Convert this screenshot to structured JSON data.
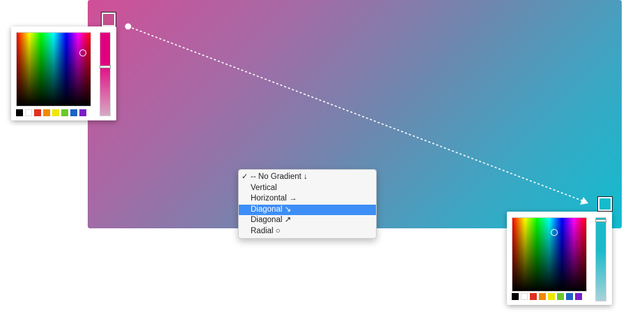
{
  "menu": {
    "items": [
      {
        "label": "-- No Gradient ↓",
        "checked": true
      },
      {
        "label": "Vertical"
      },
      {
        "label": "Horizontal →"
      },
      {
        "label": "Diagonal ↘",
        "highlighted": true
      },
      {
        "label": "Diagonal ↗"
      },
      {
        "label": "Radial ○"
      }
    ],
    "check_glyph": "✓"
  },
  "gradient": {
    "start_color": "#d14f97",
    "end_color": "#11bccf",
    "direction": "diagonal-down-right"
  },
  "start_picker": {
    "selected_color": "#c84f90",
    "hue_color": "#e2007f",
    "palette": [
      "#000000",
      "#ffffff",
      "#e03020",
      "#f08a00",
      "#f2e600",
      "#6cc72a",
      "#1b63c7",
      "#7a1ec7"
    ]
  },
  "end_picker": {
    "selected_color": "#12bccd",
    "hue_color": "#2ab8c6",
    "palette": [
      "#000000",
      "#ffffff",
      "#e03020",
      "#f08a00",
      "#f2e600",
      "#6cc72a",
      "#1b63c7",
      "#7a1ec7"
    ]
  },
  "colors": {
    "menu_highlight": "#3d8ef6",
    "menu_background": "#f6f6f6"
  },
  "icons": [
    "check-icon",
    "arrow-down-icon",
    "arrow-right-icon",
    "arrow-down-right-icon",
    "arrow-up-right-icon",
    "circle-icon"
  ]
}
